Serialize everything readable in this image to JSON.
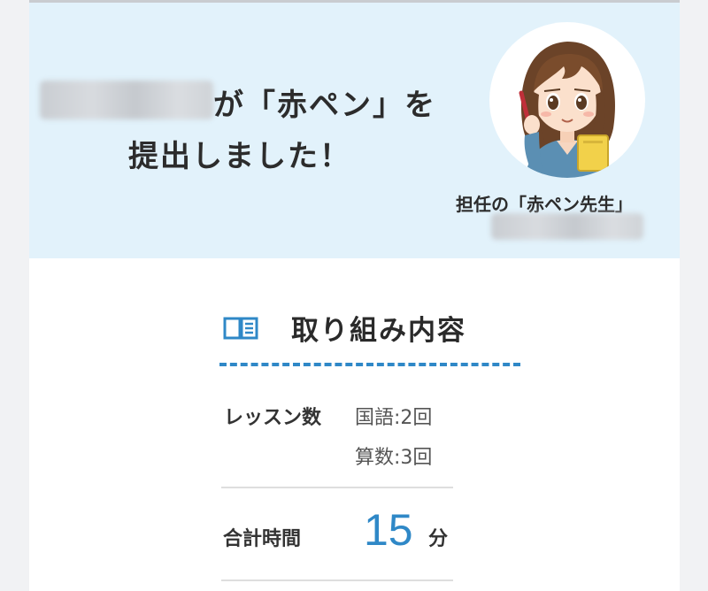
{
  "banner": {
    "message_line1": "が「赤ペン」を",
    "message_line2": "提出しました！",
    "teacher_label": "担任の「赤ペン先生」"
  },
  "section": {
    "title": "取り組み内容",
    "icon": "book-icon"
  },
  "lessons": {
    "label": "レッスン数",
    "subjects": [
      "国語:2回",
      "算数:3回"
    ]
  },
  "total_time": {
    "label": "合計時間",
    "value": "15",
    "unit": "分"
  },
  "colors": {
    "banner_bg": "#e2f2fb",
    "accent": "#2f88c7",
    "page_bg": "#ffffff"
  }
}
